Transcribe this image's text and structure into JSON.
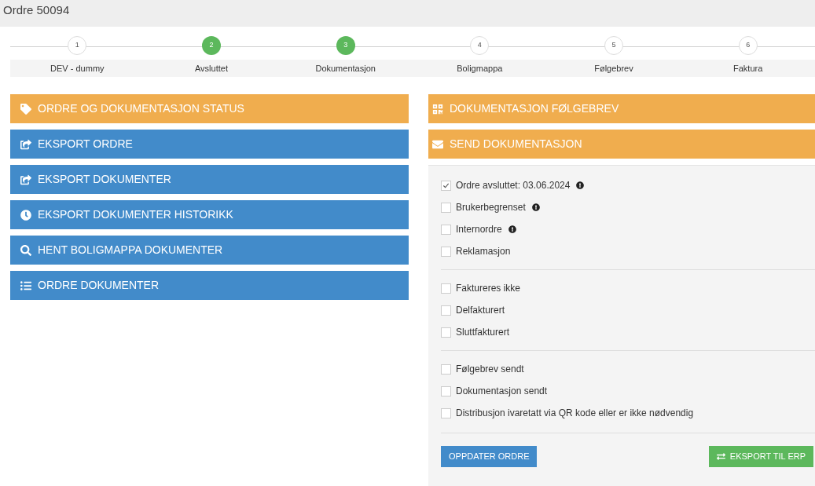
{
  "page": {
    "title": "Ordre 50094"
  },
  "steps": [
    {
      "number": "1",
      "label": "DEV - dummy",
      "done": false
    },
    {
      "number": "2",
      "label": "Avsluttet",
      "done": true
    },
    {
      "number": "3",
      "label": "Dokumentasjon",
      "done": true
    },
    {
      "number": "4",
      "label": "Boligmappa",
      "done": false
    },
    {
      "number": "5",
      "label": "Følgebrev",
      "done": false
    },
    {
      "number": "6",
      "label": "Faktura",
      "done": false
    }
  ],
  "left_panels": [
    {
      "label": "ORDRE OG DOKUMENTASJON STATUS",
      "kind": "tag",
      "color": "#f0ad4e"
    },
    {
      "label": "EKSPORT ORDRE",
      "kind": "export",
      "color": "#428bca"
    },
    {
      "label": "EKSPORT DOKUMENTER",
      "kind": "export",
      "color": "#428bca"
    },
    {
      "label": "EKSPORT DOKUMENTER HISTORIKK",
      "kind": "clock",
      "color": "#428bca"
    },
    {
      "label": "HENT BOLIGMAPPA DOKUMENTER",
      "kind": "search",
      "color": "#428bca"
    },
    {
      "label": "ORDRE DOKUMENTER",
      "kind": "list",
      "color": "#428bca"
    }
  ],
  "right_panels": [
    {
      "label": "DOKUMENTASJON FØLGEBREV",
      "kind": "qr"
    },
    {
      "label": "SEND DOKUMENTASJON",
      "kind": "envelope"
    }
  ],
  "checkbox_groups": [
    [
      {
        "label": "Ordre avsluttet: 03.06.2024",
        "checked": true,
        "info": true
      },
      {
        "label": "Brukerbegrenset",
        "checked": false,
        "info": true
      },
      {
        "label": "Internordre",
        "checked": false,
        "info": true
      },
      {
        "label": "Reklamasjon",
        "checked": false,
        "info": false
      }
    ],
    [
      {
        "label": "Faktureres ikke",
        "checked": false,
        "info": false
      },
      {
        "label": "Delfakturert",
        "checked": false,
        "info": false
      },
      {
        "label": "Sluttfakturert",
        "checked": false,
        "info": false
      }
    ],
    [
      {
        "label": "Følgebrev sendt",
        "checked": false,
        "info": false
      },
      {
        "label": "Dokumentasjon sendt",
        "checked": false,
        "info": false
      },
      {
        "label": "Distribusjon ivaretatt via QR kode eller er ikke nødvendig",
        "checked": false,
        "info": false
      }
    ]
  ],
  "buttons": {
    "update": "OPPDATER ORDRE",
    "export": "EKSPORT TIL ERP"
  }
}
